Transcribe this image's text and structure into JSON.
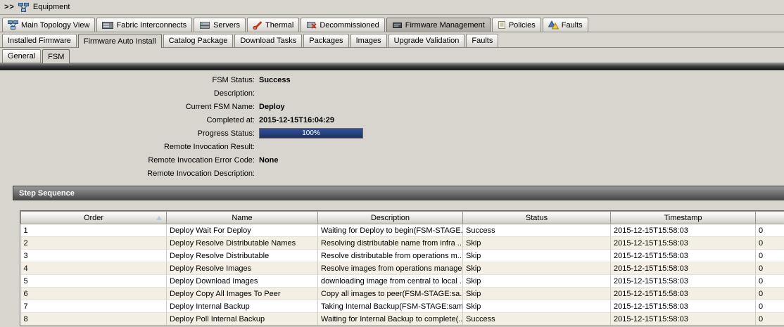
{
  "breadcrumb": {
    "chevrons": ">>",
    "label": "Equipment"
  },
  "main_tabs": [
    {
      "label": "Main Topology View",
      "icon": "topology-icon",
      "selected": false
    },
    {
      "label": "Fabric Interconnects",
      "icon": "fabric-icon",
      "selected": false
    },
    {
      "label": "Servers",
      "icon": "servers-icon",
      "selected": false
    },
    {
      "label": "Thermal",
      "icon": "thermal-icon",
      "selected": false
    },
    {
      "label": "Decommissioned",
      "icon": "decommissioned-icon",
      "selected": false
    },
    {
      "label": "Firmware Management",
      "icon": "firmware-icon",
      "selected": true
    },
    {
      "label": "Policies",
      "icon": "policies-icon",
      "selected": false
    },
    {
      "label": "Faults",
      "icon": "faults-icon",
      "selected": false
    }
  ],
  "sub_tabs": [
    {
      "label": "Installed Firmware",
      "selected": false
    },
    {
      "label": "Firmware Auto Install",
      "selected": true
    },
    {
      "label": "Catalog Package",
      "selected": false
    },
    {
      "label": "Download Tasks",
      "selected": false
    },
    {
      "label": "Packages",
      "selected": false
    },
    {
      "label": "Images",
      "selected": false
    },
    {
      "label": "Upgrade Validation",
      "selected": false
    },
    {
      "label": "Faults",
      "selected": false
    }
  ],
  "inner_tabs": [
    {
      "label": "General",
      "selected": false
    },
    {
      "label": "FSM",
      "selected": true
    }
  ],
  "fsm": {
    "fields": [
      {
        "label": "FSM Status:",
        "value": "Success",
        "type": "text"
      },
      {
        "label": "Description:",
        "value": "",
        "type": "text"
      },
      {
        "label": "Current FSM Name:",
        "value": "Deploy",
        "type": "text"
      },
      {
        "label": "Completed at:",
        "value": "2015-12-15T16:04:29",
        "type": "text"
      },
      {
        "label": "Progress Status:",
        "value": "100%",
        "type": "progress"
      },
      {
        "label": "Remote Invocation Result:",
        "value": "",
        "type": "text"
      },
      {
        "label": "Remote Invocation Error Code:",
        "value": "None",
        "type": "text"
      },
      {
        "label": "Remote Invocation Description:",
        "value": "",
        "type": "text"
      }
    ],
    "progress": {
      "percent": 100,
      "label": "100%",
      "bar_color": "#1c3164",
      "bar_color_top": "#33509a"
    }
  },
  "step_sequence": {
    "title": "Step Sequence",
    "table": {
      "columns": [
        "Order",
        "Name",
        "Description",
        "Status",
        "Timestamp",
        ""
      ],
      "sorted_column": "Order",
      "rows": [
        [
          "1",
          "Deploy Wait For Deploy",
          "Waiting for Deploy to begin(FSM-STAGE...",
          "Success",
          "2015-12-15T15:58:03",
          "0"
        ],
        [
          "2",
          "Deploy Resolve Distributable Names",
          "Resolving distributable name from infra ...",
          "Skip",
          "2015-12-15T15:58:03",
          "0"
        ],
        [
          "3",
          "Deploy Resolve Distributable",
          "Resolve distributable from operations m...",
          "Skip",
          "2015-12-15T15:58:03",
          "0"
        ],
        [
          "4",
          "Deploy Resolve Images",
          "Resolve images from operations manage...",
          "Skip",
          "2015-12-15T15:58:03",
          "0"
        ],
        [
          "5",
          "Deploy Download Images",
          "downloading image from central to local ...",
          "Skip",
          "2015-12-15T15:58:03",
          "0"
        ],
        [
          "6",
          "Deploy Copy All Images To Peer",
          "Copy all images to peer(FSM-STAGE:sa...",
          "Skip",
          "2015-12-15T15:58:03",
          "0"
        ],
        [
          "7",
          "Deploy Internal Backup",
          "Taking Internal Backup(FSM-STAGE:sam...",
          "Skip",
          "2015-12-15T15:58:03",
          "0"
        ],
        [
          "8",
          "Deploy Poll Internal Backup",
          "Waiting for Internal Backup to complete(...",
          "Success",
          "2015-12-15T15:58:03",
          "0"
        ]
      ]
    }
  },
  "colors": {
    "progress_bar": "#1c3164",
    "row_alternate": "#f3efe4",
    "band": "#2e2e2e"
  }
}
